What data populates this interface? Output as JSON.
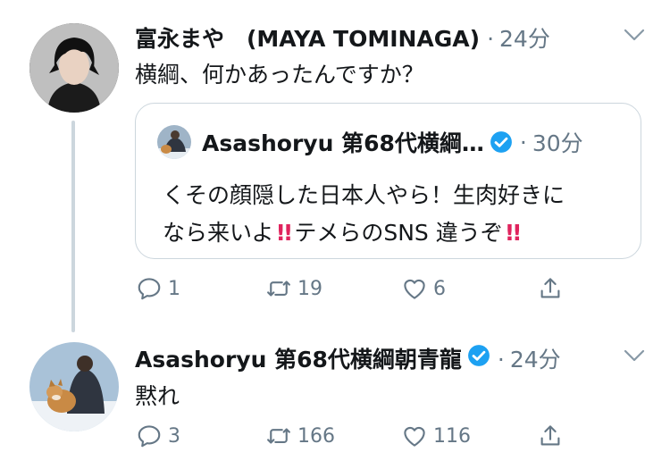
{
  "reply": {
    "author": "富永まや　(MAYA TOMINAGA)",
    "dot": "·",
    "time": "24分",
    "text": "横綱、何かあったんですか？",
    "quote": {
      "author": "Asashoryu 第68代横綱…",
      "dot": "·",
      "time": "30分",
      "line1": "くその顔隠した日本人やら！生肉好きに",
      "line2a": "なら来いよ",
      "line2b": "テメらのSNS 違うぞ",
      "bang": "!!"
    },
    "stats": {
      "replies": "1",
      "retweets": "19",
      "likes": "6"
    }
  },
  "tweet2": {
    "author": "Asashoryu 第68代横綱朝青龍",
    "dot": "·",
    "time": "24分",
    "text": "黙れ",
    "stats": {
      "replies": "3",
      "retweets": "166",
      "likes": "116"
    }
  },
  "colors": {
    "text": "#14171a",
    "secondary": "#657786",
    "border": "#ccd6dd",
    "verified": "#1da1f2",
    "emoji_red": "#e0245e"
  },
  "icons": [
    "reply-icon",
    "retweet-icon",
    "like-icon",
    "share-icon",
    "chevron-down-icon",
    "verified-badge-icon"
  ]
}
